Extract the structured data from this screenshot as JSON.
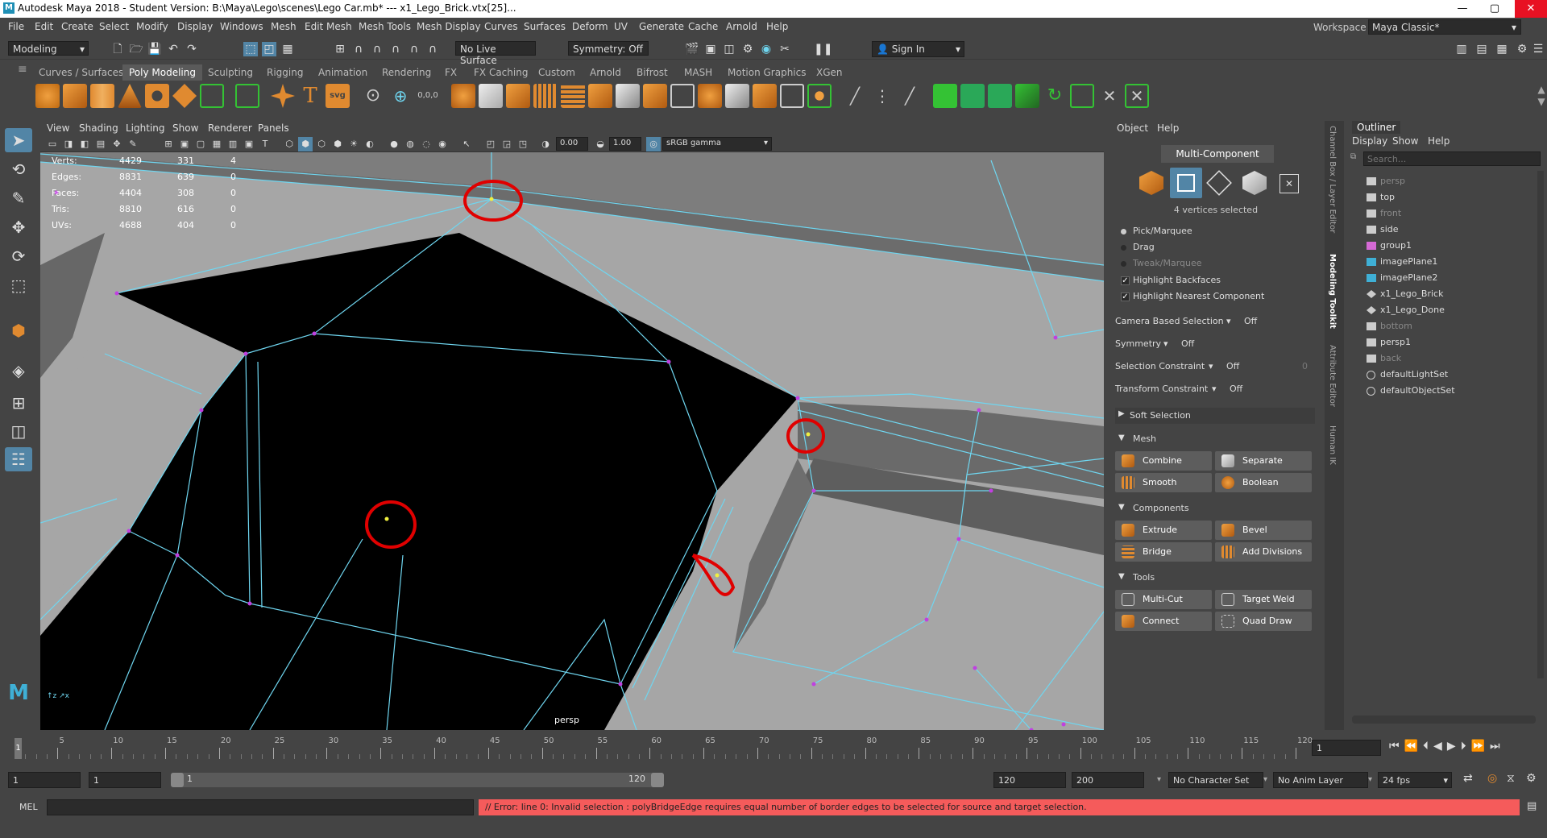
{
  "window": {
    "title": "Autodesk Maya 2018 - Student Version: B:\\Maya\\Lego\\scenes\\Lego Car.mb*   ---   x1_Lego_Brick.vtx[25]...",
    "controls": [
      "—",
      "▢",
      "✕"
    ]
  },
  "menubar": [
    "File",
    "Edit",
    "Create",
    "Select",
    "Modify",
    "Display",
    "Windows",
    "Mesh",
    "Edit Mesh",
    "Mesh Tools",
    "Mesh Display",
    "Curves",
    "Surfaces",
    "Deform",
    "UV",
    "Generate",
    "Cache",
    "Arnold",
    "Help"
  ],
  "workspace": {
    "label": "Workspace :",
    "value": "Maya Classic*"
  },
  "status_line": {
    "mode": "Modeling",
    "live_surface": "No Live Surface",
    "symmetry": "Symmetry: Off",
    "sign_in": "Sign In"
  },
  "shelf_tabs": [
    "Curves / Surfaces",
    "Poly Modeling",
    "Sculpting",
    "Rigging",
    "Animation",
    "Rendering",
    "FX",
    "FX Caching",
    "Custom",
    "Arnold",
    "Bifrost",
    "MASH",
    "Motion Graphics",
    "XGen"
  ],
  "shelf_active_tab": "Poly Modeling",
  "viewport": {
    "menus": [
      "View",
      "Shading",
      "Lighting",
      "Show",
      "Renderer",
      "Panels"
    ],
    "exposure": "0.00",
    "gamma": "1.00",
    "color_space": "sRGB gamma",
    "camera_label": "persp",
    "hud": [
      {
        "label": "Verts:",
        "a": "4429",
        "b": "331",
        "c": "4"
      },
      {
        "label": "Edges:",
        "a": "8831",
        "b": "639",
        "c": "0"
      },
      {
        "label": "Faces:",
        "a": "4404",
        "b": "308",
        "c": "0"
      },
      {
        "label": "Tris:",
        "a": "8810",
        "b": "616",
        "c": "0"
      },
      {
        "label": "UVs:",
        "a": "4688",
        "b": "404",
        "c": "0"
      }
    ]
  },
  "modeling_toolkit": {
    "menus": [
      "Object",
      "Help"
    ],
    "mode_button": "Multi-Component",
    "selection_info": "4 vertices selected",
    "pick_options": [
      {
        "label": "Pick/Marquee",
        "active": true
      },
      {
        "label": "Drag",
        "active": false
      },
      {
        "label": "Tweak/Marquee",
        "active": false
      }
    ],
    "checkboxes": [
      {
        "label": "Highlight Backfaces",
        "checked": true
      },
      {
        "label": "Highlight Nearest Component",
        "checked": true
      }
    ],
    "settings": [
      {
        "label": "Camera Based Selection",
        "value": "Off"
      },
      {
        "label": "Symmetry",
        "value": "Off"
      },
      {
        "label": "Selection Constraint",
        "value": "Off",
        "extra": "0"
      },
      {
        "label": "Transform Constraint",
        "value": "Off"
      }
    ],
    "soft_selection": "Soft Selection",
    "sections": [
      {
        "title": "Mesh",
        "buttons": [
          "Combine",
          "Separate",
          "Smooth",
          "Boolean"
        ]
      },
      {
        "title": "Components",
        "buttons": [
          "Extrude",
          "Bevel",
          "Bridge",
          "Add Divisions"
        ]
      },
      {
        "title": "Tools",
        "buttons": [
          "Multi-Cut",
          "Target Weld",
          "Connect",
          "Quad Draw"
        ]
      }
    ],
    "side_tabs": [
      "Channel Box / Layer Editor",
      "Modeling Toolkit",
      "Attribute Editor",
      "Human IK"
    ]
  },
  "outliner": {
    "title": "Outliner",
    "menus": [
      "Display",
      "Show",
      "Help"
    ],
    "search_placeholder": "Search...",
    "items": [
      {
        "name": "persp",
        "dim": true
      },
      {
        "name": "top",
        "dim": false
      },
      {
        "name": "front",
        "dim": true
      },
      {
        "name": "side",
        "dim": false
      },
      {
        "name": "group1",
        "dim": false
      },
      {
        "name": "imagePlane1",
        "dim": false
      },
      {
        "name": "imagePlane2",
        "dim": false
      },
      {
        "name": "x1_Lego_Brick",
        "dim": false
      },
      {
        "name": "x1_Lego_Done",
        "dim": false
      },
      {
        "name": "bottom",
        "dim": true
      },
      {
        "name": "persp1",
        "dim": false
      },
      {
        "name": "back",
        "dim": true
      },
      {
        "name": "defaultLightSet",
        "dim": false
      },
      {
        "name": "defaultObjectSet",
        "dim": false
      }
    ]
  },
  "timeline": {
    "ticks": [
      "1",
      "5",
      "10",
      "15",
      "20",
      "25",
      "30",
      "35",
      "40",
      "45",
      "50",
      "55",
      "60",
      "65",
      "70",
      "75",
      "80",
      "85",
      "90",
      "95",
      "100",
      "105",
      "110",
      "115",
      "120"
    ],
    "current_frame": "1"
  },
  "range": {
    "start": "1",
    "playback_start": "1",
    "slider_start": "1",
    "slider_end": "120",
    "playback_end": "120",
    "end": "200",
    "character_set": "No Character Set",
    "anim_layer": "No Anim Layer",
    "fps": "24 fps"
  },
  "command_line": {
    "lang": "MEL",
    "error": "// Error: line 0: Invalid selection : polyBridgeEdge requires equal number of border edges to be selected for source and target selection."
  },
  "colors": {
    "error_bg": "#f55b5b",
    "wire": "#6fd6f0",
    "vertex": "#c040e0",
    "annotation": "#e00000",
    "highlight": "#5285a6"
  }
}
